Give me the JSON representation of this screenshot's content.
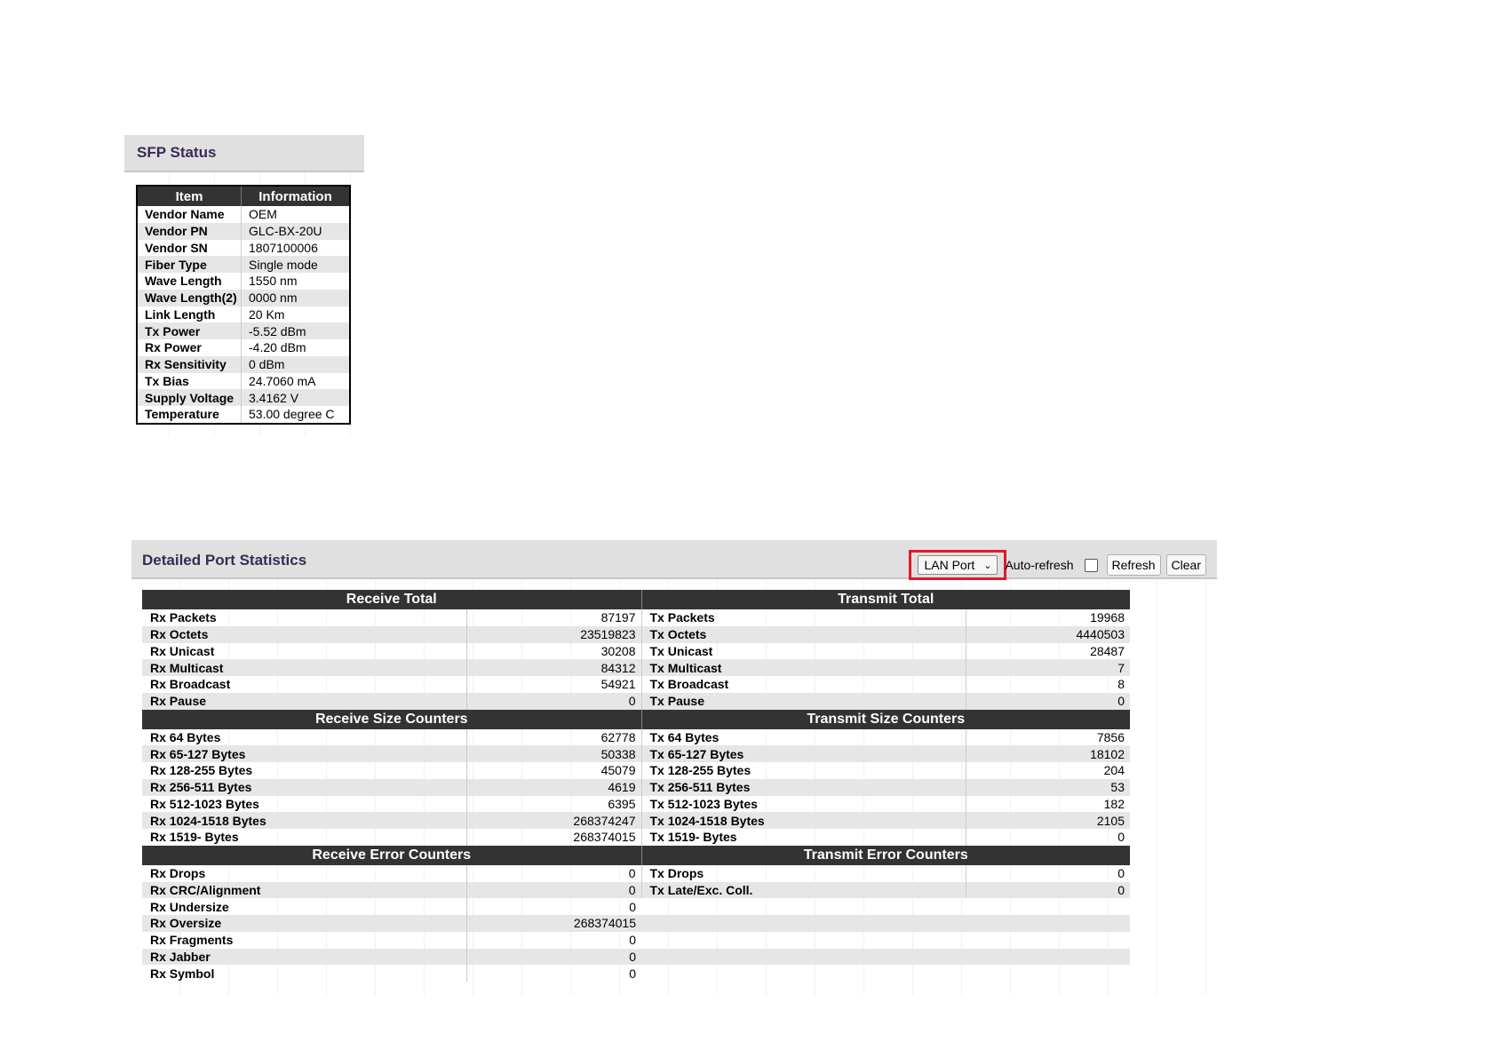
{
  "sfp_status": {
    "title": "SFP Status",
    "headers": [
      "Item",
      "Information"
    ],
    "rows": [
      {
        "item": "Vendor Name",
        "info": "OEM"
      },
      {
        "item": "Vendor PN",
        "info": "GLC-BX-20U"
      },
      {
        "item": "Vendor SN",
        "info": "1807100006"
      },
      {
        "item": "Fiber Type",
        "info": "Single mode"
      },
      {
        "item": "Wave Length",
        "info": "1550 nm"
      },
      {
        "item": "Wave Length(2)",
        "info": "0000 nm"
      },
      {
        "item": "Link Length",
        "info": "20 Km"
      },
      {
        "item": "Tx Power",
        "info": "-5.52 dBm"
      },
      {
        "item": "Rx Power",
        "info": "-4.20 dBm"
      },
      {
        "item": "Rx Sensitivity",
        "info": "0 dBm"
      },
      {
        "item": "Tx Bias",
        "info": "24.7060 mA"
      },
      {
        "item": "Supply Voltage",
        "info": "3.4162 V"
      },
      {
        "item": "Temperature",
        "info": "53.00 degree C"
      }
    ]
  },
  "port_stats": {
    "title": "Detailed Port Statistics",
    "controls": {
      "port_select": "LAN Port",
      "auto_refresh_label": "Auto-refresh",
      "auto_refresh_checked": false,
      "refresh_label": "Refresh",
      "clear_label": "Clear",
      "highlight_color": "#e0192b"
    },
    "sections": [
      {
        "rx_title": "Receive Total",
        "tx_title": "Transmit Total",
        "rows": [
          {
            "rx_label": "Rx Packets",
            "rx_value": "87197",
            "tx_label": "Tx Packets",
            "tx_value": "19968"
          },
          {
            "rx_label": "Rx Octets",
            "rx_value": "23519823",
            "tx_label": "Tx Octets",
            "tx_value": "4440503"
          },
          {
            "rx_label": "Rx Unicast",
            "rx_value": "30208",
            "tx_label": "Tx Unicast",
            "tx_value": "28487"
          },
          {
            "rx_label": "Rx Multicast",
            "rx_value": "84312",
            "tx_label": "Tx Multicast",
            "tx_value": "7"
          },
          {
            "rx_label": "Rx Broadcast",
            "rx_value": "54921",
            "tx_label": "Tx Broadcast",
            "tx_value": "8"
          },
          {
            "rx_label": "Rx Pause",
            "rx_value": "0",
            "tx_label": "Tx Pause",
            "tx_value": "0"
          }
        ]
      },
      {
        "rx_title": "Receive Size Counters",
        "tx_title": "Transmit Size Counters",
        "rows": [
          {
            "rx_label": "Rx 64 Bytes",
            "rx_value": "62778",
            "tx_label": "Tx 64 Bytes",
            "tx_value": "7856"
          },
          {
            "rx_label": "Rx 65-127 Bytes",
            "rx_value": "50338",
            "tx_label": "Tx 65-127 Bytes",
            "tx_value": "18102"
          },
          {
            "rx_label": "Rx 128-255 Bytes",
            "rx_value": "45079",
            "tx_label": "Tx 128-255 Bytes",
            "tx_value": "204"
          },
          {
            "rx_label": "Rx 256-511 Bytes",
            "rx_value": "4619",
            "tx_label": "Tx 256-511 Bytes",
            "tx_value": "53"
          },
          {
            "rx_label": "Rx 512-1023 Bytes",
            "rx_value": "6395",
            "tx_label": "Tx 512-1023 Bytes",
            "tx_value": "182"
          },
          {
            "rx_label": "Rx 1024-1518 Bytes",
            "rx_value": "268374247",
            "tx_label": "Tx 1024-1518 Bytes",
            "tx_value": "2105"
          },
          {
            "rx_label": "Rx 1519- Bytes",
            "rx_value": "268374015",
            "tx_label": "Tx 1519- Bytes",
            "tx_value": "0"
          }
        ]
      },
      {
        "rx_title": "Receive Error Counters",
        "tx_title": "Transmit Error Counters",
        "rows": [
          {
            "rx_label": "Rx Drops",
            "rx_value": "0",
            "tx_label": "Tx Drops",
            "tx_value": "0"
          },
          {
            "rx_label": "Rx CRC/Alignment",
            "rx_value": "0",
            "tx_label": "Tx Late/Exc. Coll.",
            "tx_value": "0"
          },
          {
            "rx_label": "Rx Undersize",
            "rx_value": "0",
            "tx_label": "",
            "tx_value": ""
          },
          {
            "rx_label": "Rx Oversize",
            "rx_value": "268374015",
            "tx_label": "",
            "tx_value": ""
          },
          {
            "rx_label": "Rx Fragments",
            "rx_value": "0",
            "tx_label": "",
            "tx_value": ""
          },
          {
            "rx_label": "Rx Jabber",
            "rx_value": "0",
            "tx_label": "",
            "tx_value": ""
          },
          {
            "rx_label": "Rx Symbol",
            "rx_value": "0",
            "tx_label": "",
            "tx_value": ""
          }
        ]
      }
    ]
  }
}
